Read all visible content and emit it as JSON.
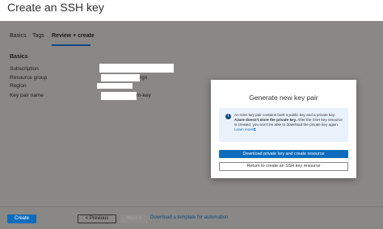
{
  "header": {
    "title": "Create an SSH key",
    "more_icon": "ellipsis-icon",
    "more_glyph": "···"
  },
  "tabs": [
    {
      "label": "Basics",
      "selected": false
    },
    {
      "label": "Tags",
      "selected": false
    },
    {
      "label": "Review + create",
      "selected": true
    }
  ],
  "summary": {
    "section_title": "Basics",
    "fields": [
      {
        "label": "Subscription",
        "visible_value": ""
      },
      {
        "label": "Resource group",
        "visible_value": "rgo"
      },
      {
        "label": "Region",
        "visible_value": ""
      },
      {
        "label": "Key pair name",
        "visible_value": "m-key"
      }
    ]
  },
  "modal": {
    "title": "Generate new key pair",
    "info_icon": "info-icon",
    "info_glyph": "i",
    "info_part1": "An SSH key pair contains both a public key and a private key. ",
    "info_bold": "Azure doesn't store the private key.",
    "info_part2": " After the SSH key resource is created, you won't be able to download the private key again. ",
    "learn_more": "Learn more",
    "external_link_icon": "external-link-icon",
    "external_glyph": "⧉",
    "primary_button": "Download private key and create resource",
    "secondary_button": "Return to create an SSH key resource"
  },
  "footer": {
    "create_button": "Create",
    "previous_button": "< Previous",
    "next_button": "Next >",
    "automation_link": "Download a template for automation"
  },
  "colors": {
    "accent": "#0f6cbd",
    "overlay": "#8a8886",
    "info_background": "#e9f1fb"
  }
}
